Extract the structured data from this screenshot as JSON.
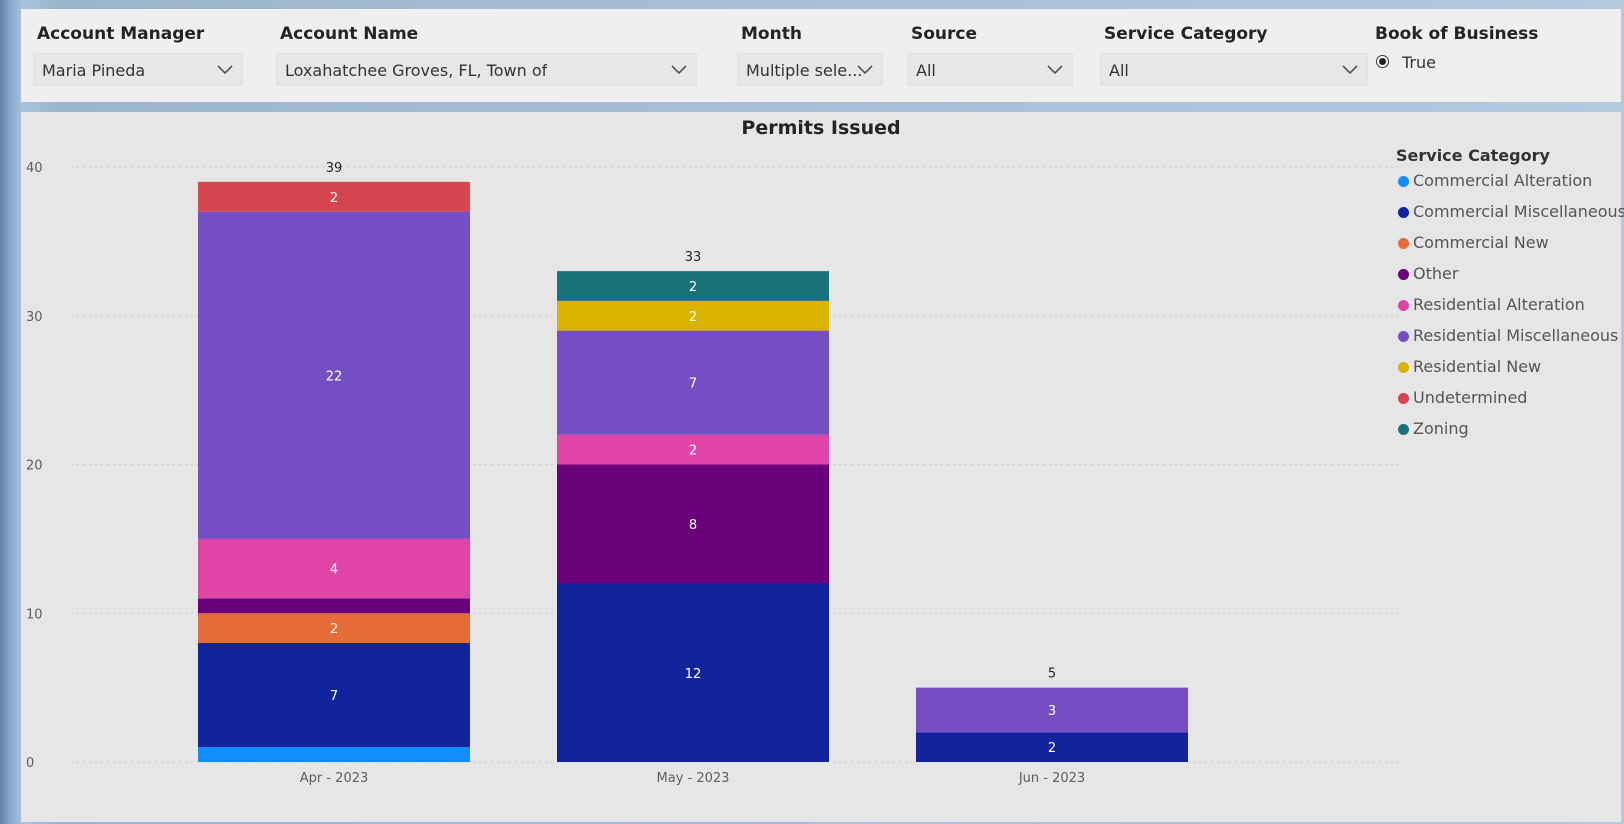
{
  "filters": {
    "account_manager": {
      "label": "Account Manager",
      "value": "Maria Pineda"
    },
    "account_name": {
      "label": "Account Name",
      "value": "Loxahatchee Groves, FL, Town of"
    },
    "month": {
      "label": "Month",
      "value": "Multiple sele..."
    },
    "source": {
      "label": "Source",
      "value": "All"
    },
    "service_category": {
      "label": "Service Category",
      "value": "All"
    },
    "book_of_business": {
      "label": "Book of Business",
      "option": "True",
      "selected": true
    }
  },
  "legend": {
    "title": "Service Category",
    "items": [
      {
        "label": "Commercial Alteration",
        "color": "#118dff"
      },
      {
        "label": "Commercial Miscellaneous",
        "color": "#12239e"
      },
      {
        "label": "Commercial New",
        "color": "#e66c37"
      },
      {
        "label": "Other",
        "color": "#6b007b"
      },
      {
        "label": "Residential Alteration",
        "color": "#e044a7"
      },
      {
        "label": "Residential Miscellaneous",
        "color": "#744ec2"
      },
      {
        "label": "Residential New",
        "color": "#d9b300"
      },
      {
        "label": "Undetermined",
        "color": "#d64550"
      },
      {
        "label": "Zoning",
        "color": "#197278"
      }
    ]
  },
  "chart_data": {
    "type": "bar",
    "stacked": true,
    "title": "Permits Issued",
    "xlabel": "",
    "ylabel": "",
    "ylim": [
      0,
      40
    ],
    "yticks": [
      0,
      10,
      20,
      30,
      40
    ],
    "grid": true,
    "legend_position": "right",
    "categories": [
      "Apr - 2023",
      "May - 2023",
      "Jun - 2023"
    ],
    "totals": [
      39,
      33,
      5
    ],
    "series": [
      {
        "name": "Commercial Alteration",
        "color": "#118dff",
        "values": [
          1,
          0,
          0
        ],
        "labels": [
          "",
          "",
          ""
        ]
      },
      {
        "name": "Commercial Miscellaneous",
        "color": "#12239e",
        "values": [
          7,
          12,
          2
        ],
        "labels": [
          "7",
          "12",
          "2"
        ]
      },
      {
        "name": "Commercial New",
        "color": "#e66c37",
        "values": [
          2,
          0,
          0
        ],
        "labels": [
          "2",
          "",
          ""
        ]
      },
      {
        "name": "Other",
        "color": "#6b007b",
        "values": [
          1,
          8,
          0
        ],
        "labels": [
          "",
          "8",
          ""
        ]
      },
      {
        "name": "Residential Alteration",
        "color": "#e044a7",
        "values": [
          4,
          2,
          0
        ],
        "labels": [
          "4",
          "2",
          ""
        ]
      },
      {
        "name": "Residential Miscellaneous",
        "color": "#744ec2",
        "values": [
          22,
          7,
          3
        ],
        "labels": [
          "22",
          "7",
          "3"
        ]
      },
      {
        "name": "Residential New",
        "color": "#d9b300",
        "values": [
          0,
          2,
          0
        ],
        "labels": [
          "",
          "2",
          ""
        ]
      },
      {
        "name": "Undetermined",
        "color": "#d64550",
        "values": [
          2,
          0,
          0
        ],
        "labels": [
          "2",
          "",
          ""
        ]
      },
      {
        "name": "Zoning",
        "color": "#197278",
        "values": [
          0,
          2,
          0
        ],
        "labels": [
          "",
          "2",
          ""
        ]
      }
    ]
  }
}
